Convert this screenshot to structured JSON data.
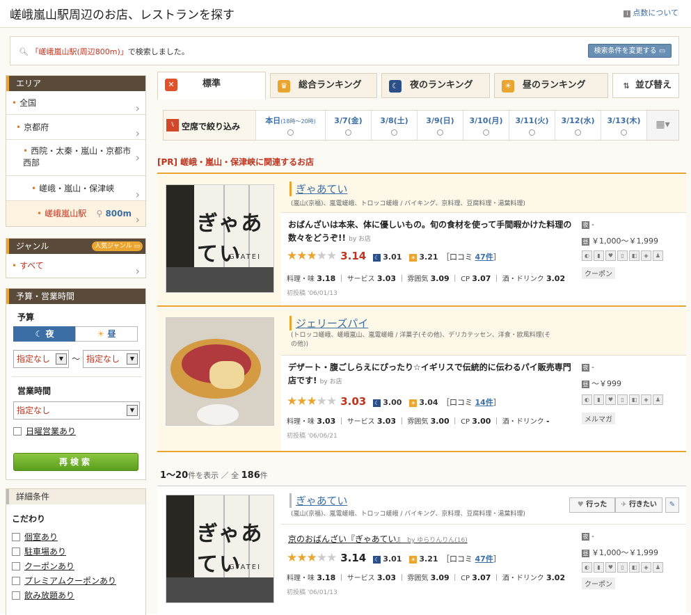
{
  "header": {
    "title": "嵯峨嵐山駅周辺のお店、レストランを探す",
    "help": "点数について"
  },
  "notice": {
    "area": "「嵯峨嵐山駅(周辺800m)」",
    "suffix": "で検索しました。",
    "change_button": "検索条件を変更する"
  },
  "sidebar": {
    "area_title": "エリア",
    "area_items": [
      {
        "label": "全国"
      },
      {
        "label": "京都府"
      },
      {
        "label": "西院・太秦・嵐山・京都市西部"
      },
      {
        "label": "嵯峨・嵐山・保津峡"
      },
      {
        "label": "嵯峨嵐山駅",
        "distance": "800m"
      }
    ],
    "genre_title": "ジャンル",
    "genre_badge": "人気ジャンル",
    "genre_item": "すべて",
    "budget_section_title": "予算・営業時間",
    "budget_label": "予算",
    "night_toggle": "夜",
    "day_toggle": "昼",
    "budget_min": "指定なし",
    "budget_sep": "〜",
    "budget_max": "指定なし",
    "hours_label": "営業時間",
    "hours_select": "指定なし",
    "sunday_label": "日曜営業あり",
    "research_button": "再検索",
    "detail_title": "詳細条件",
    "kodawari_label": "こだわり",
    "checks": [
      "個室あり",
      "駐車場あり",
      "クーポンあり",
      "プレミアムクーポンあり",
      "飲み放題あり"
    ]
  },
  "tabs": [
    {
      "label": "標準",
      "icon": "cutlery-icon"
    },
    {
      "label": "総合ランキング",
      "icon": "crown-icon"
    },
    {
      "label": "夜のランキング",
      "icon": "moon-icon"
    },
    {
      "label": "昼のランキング",
      "icon": "sun-icon"
    },
    {
      "label": "並び替え",
      "icon": "sort-icon"
    }
  ],
  "datebar": {
    "filter_label": "空席で絞り込み",
    "today": "本日",
    "today_time": "(18時〜20時)",
    "dates": [
      "3/7(金)",
      "3/8(土)",
      "3/9(日)",
      "3/10(月)",
      "3/11(火)",
      "3/12(水)",
      "3/13(木)"
    ]
  },
  "pr_title": "[PR] 嵯峨・嵐山・保津峡に関連するお店",
  "results": {
    "range": "1〜20",
    "range_suffix": "件を表示 ／ 全",
    "total": "186",
    "total_suffix": "件"
  },
  "buttons": {
    "went": "行った",
    "want": "行きたい"
  },
  "restaurants": [
    {
      "name": "ぎゃあてい",
      "category": "(嵐山(京福)、嵐電嵯峨、トロッコ嵯峨 / バイキング、京料理、豆腐料理・湯葉料理)",
      "catch": "おばんざいは本来、体に優しいもの。旬の食材を使って手間暇かけた料理の数々をどうぞ!!",
      "by": "by お店",
      "score": "3.14",
      "night": "3.01",
      "day": "3.21",
      "stars": 3,
      "review_label": "口コミ",
      "reviews": "47件",
      "taste": "3.18",
      "service": "3.03",
      "mood": "3.09",
      "cp": "3.07",
      "drink": "3.02",
      "first_post": "初投稿 '06/01/13",
      "night_budget": "-",
      "day_budget": "￥1,000〜￥1,999",
      "tag": "クーポン"
    },
    {
      "name": "ジェリーズパイ",
      "category": "(トロッコ嵯峨、嵯峨嵐山、嵐電嵯峨 / 洋菓子(その他)、デリカテッセン、洋食・欧風料理(その他))",
      "catch": "デザート・腹ごしらえにぴったり☆イギリスで伝統的に伝わるパイ販売専門店です!",
      "by": "by お店",
      "score": "3.03",
      "night": "3.00",
      "day": "3.04",
      "stars": 3,
      "review_label": "口コミ",
      "reviews": "14件",
      "taste": "3.03",
      "service": "3.03",
      "mood": "3.00",
      "cp": "3.00",
      "drink": "-",
      "first_post": "初投稿 '06/06/21",
      "night_budget": "-",
      "day_budget": "〜￥999",
      "tag": "メルマガ"
    },
    {
      "name": "ぎゃあてい",
      "category": "(嵐山(京福)、嵐電嵯峨、トロッコ嵯峨 / バイキング、京料理、豆腐料理・湯葉料理)",
      "catch": "京のおばんざい『ぎゃあてい』",
      "by": "by ゆらりんりん(16)",
      "score": "3.14",
      "night": "3.01",
      "day": "3.21",
      "stars": 3,
      "review_label": "口コミ",
      "reviews": "47件",
      "taste": "3.18",
      "service": "3.03",
      "mood": "3.09",
      "cp": "3.07",
      "drink": "3.02",
      "first_post": "初投稿 '06/01/13",
      "night_budget": "-",
      "day_budget": "￥1,000〜￥1,999",
      "tag": "クーポン"
    }
  ],
  "labels": {
    "taste": "料理・味",
    "service": "サービス",
    "mood": "雰囲気",
    "cp": "CP",
    "drink": "酒・ドリンク"
  },
  "photo_text": {
    "shop_sign": "嵐山 ぎゃあてい",
    "shop_sign_romaji": "GYATEI"
  }
}
